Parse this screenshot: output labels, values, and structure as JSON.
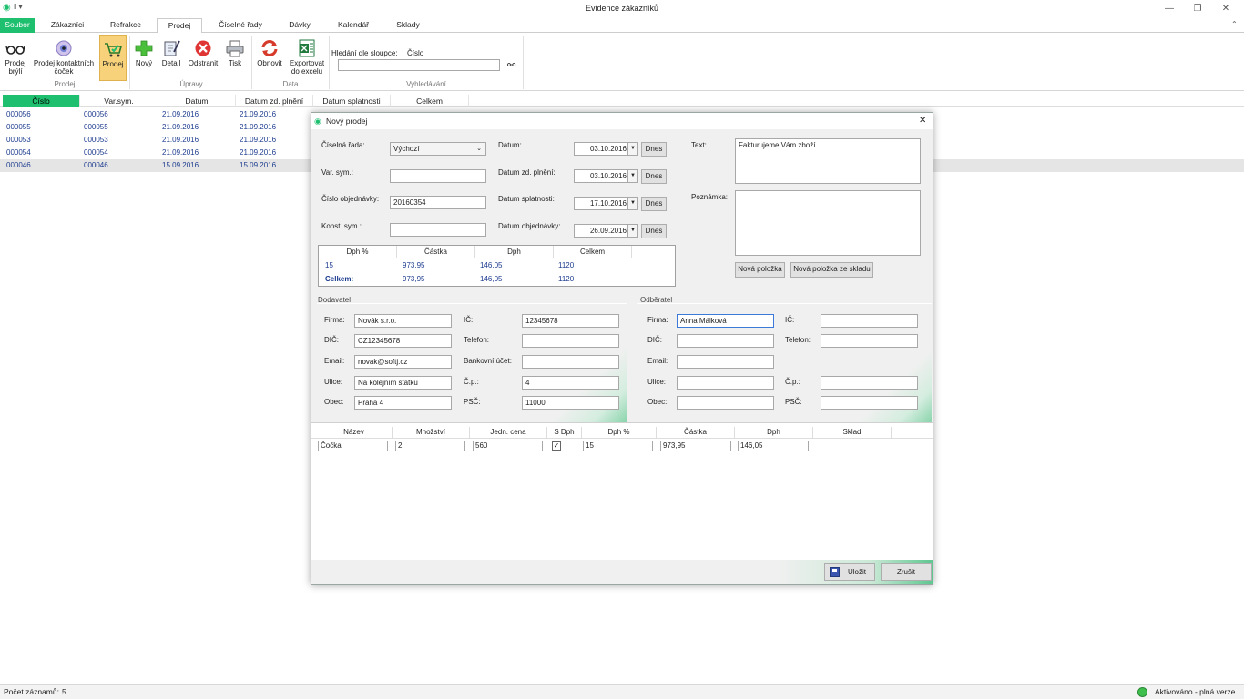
{
  "window": {
    "title": "Evidence zákazníků"
  },
  "tabs": {
    "file": "Soubor",
    "items": [
      "Zákazníci",
      "Refrakce",
      "Prodej",
      "Číselné řady",
      "Dávky",
      "Kalendář",
      "Sklady"
    ]
  },
  "ribbon": {
    "prodej_bryli": "Prodej brýlí",
    "prodej_cocek": "Prodej kontaktních čoček",
    "prodej": "Prodej",
    "novy": "Nový",
    "detail": "Detail",
    "odstranit": "Odstranit",
    "tisk": "Tisk",
    "obnovit": "Obnovit",
    "export": "Exportovat do excelu",
    "search_label": "Hledání dle sloupce:",
    "search_column": "Číslo",
    "search_value": "",
    "groups": {
      "prodej": "Prodej",
      "upravy": "Úpravy",
      "data": "Data",
      "vyhledavani": "Vyhledávání"
    }
  },
  "grid": {
    "columns": [
      "Číslo",
      "Var.sym.",
      "Datum",
      "Datum zd. plnění",
      "Datum splatnosti",
      "Celkem"
    ],
    "rows": [
      [
        "000056",
        "000056",
        "21.09.2016",
        "21.09.2016"
      ],
      [
        "000055",
        "000055",
        "21.09.2016",
        "21.09.2016"
      ],
      [
        "000053",
        "000053",
        "21.09.2016",
        "21.09.2016"
      ],
      [
        "000054",
        "000054",
        "21.09.2016",
        "21.09.2016"
      ],
      [
        "000046",
        "000046",
        "15.09.2016",
        "15.09.2016"
      ]
    ]
  },
  "status": {
    "count_label": "Počet záznamů:",
    "count": "5",
    "activation": "Aktivováno - plná verze"
  },
  "dialog": {
    "title": "Nový prodej",
    "ciselna_rada_label": "Číselná řada:",
    "ciselna_rada": "Výchozí",
    "var_sym_label": "Var. sym.:",
    "var_sym": "",
    "cislo_obj_label": "Číslo objednávky:",
    "cislo_obj": "20160354",
    "konst_sym_label": "Konst. sym.:",
    "konst_sym": "",
    "datum_label": "Datum:",
    "datum": "03.10.2016",
    "datum_zd_label": "Datum zd. plnění:",
    "datum_zd": "03.10.2016",
    "datum_spl_label": "Datum splatnosti:",
    "datum_spl": "17.10.2016",
    "datum_obj_label": "Datum objednávky:",
    "datum_obj": "26.09.2016",
    "dnes": "Dnes",
    "text_label": "Text:",
    "text_value": "Fakturujeme Vám zboží",
    "poznamka_label": "Poznámka:",
    "nova_polozka": "Nová položka",
    "nova_polozka_sklad": "Nová položka ze skladu",
    "vat": {
      "headers": [
        "Dph %",
        "Částka",
        "Dph",
        "Celkem"
      ],
      "row": [
        "15",
        "973,95",
        "146,05",
        "1120"
      ],
      "total": [
        "Celkem:",
        "973,95",
        "146,05",
        "1120"
      ]
    },
    "dodavatel": {
      "title": "Dodavatel",
      "firma_label": "Firma:",
      "firma": "Novák s.r.o.",
      "ic_label": "IČ:",
      "ic": "12345678",
      "dic_label": "DIČ:",
      "dic": "CZ12345678",
      "telefon_label": "Telefon:",
      "telefon": "",
      "email_label": "Email:",
      "email": "novak@softj.cz",
      "ucet_label": "Bankovní účet:",
      "ucet": "",
      "ulice_label": "Ulice:",
      "ulice": "Na kolejním statku",
      "cp_label": "Č.p.:",
      "cp": "4",
      "obec_label": "Obec:",
      "obec": "Praha 4",
      "psc_label": "PSČ:",
      "psc": "11000"
    },
    "odberatel": {
      "title": "Odběratel",
      "firma_label": "Firma:",
      "firma": "Anna Málková",
      "ic_label": "IČ:",
      "ic": "",
      "dic_label": "DIČ:",
      "dic": "",
      "telefon_label": "Telefon:",
      "telefon": "",
      "email_label": "Email:",
      "email": "",
      "ulice_label": "Ulice:",
      "ulice": "",
      "cp_label": "Č.p.:",
      "cp": "",
      "obec_label": "Obec:",
      "obec": "",
      "psc_label": "PSČ:",
      "psc": ""
    },
    "items": {
      "headers": [
        "Název",
        "Množství",
        "Jedn. cena",
        "S Dph",
        "Dph %",
        "Částka",
        "Dph",
        "Sklad"
      ],
      "row": {
        "nazev": "Čočka",
        "mnozstvi": "2",
        "cena": "560",
        "s_dph": true,
        "dph_pct": "15",
        "castka": "973,95",
        "dph": "146,05"
      }
    },
    "ulozit": "Uložit",
    "zrusit": "Zrušit"
  }
}
